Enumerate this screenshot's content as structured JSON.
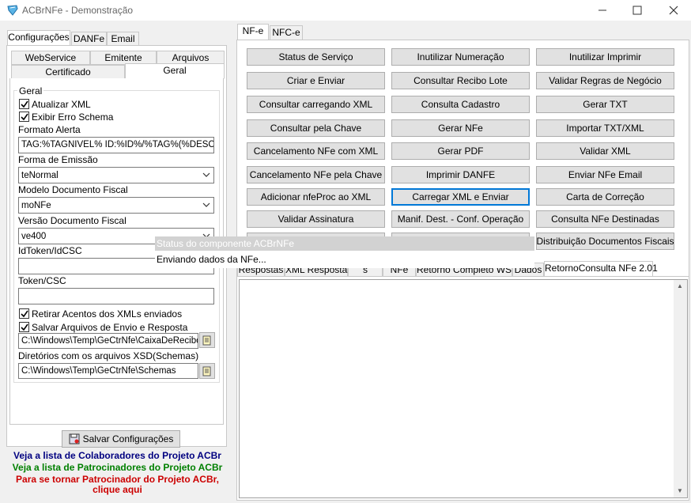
{
  "window": {
    "title": "ACBrNFe - Demonstração"
  },
  "left": {
    "tabs": [
      "Configurações",
      "DANFe",
      "Email"
    ],
    "subtabs_row1": [
      "WebService",
      "Emitente",
      "Arquivos"
    ],
    "subtabs_row2": [
      "Certificado",
      "Geral"
    ],
    "group_title": "Geral",
    "atualizar_xml": "Atualizar XML",
    "exibir_erro": "Exibir Erro Schema",
    "formato_alerta_label": "Formato Alerta",
    "formato_alerta_value": "TAG:%TAGNIVEL% ID:%ID%/%TAG%(%DESCRICAO%",
    "forma_emissao_label": "Forma de Emissão",
    "forma_emissao_value": "teNormal",
    "modelo_label": "Modelo Documento Fiscal",
    "modelo_value": "moNFe",
    "versao_label": "Versão Documento Fiscal",
    "versao_value": "ve400",
    "idtoken_label": "IdToken/IdCSC",
    "idtoken_value": "",
    "token_label": "Token/CSC",
    "token_value": "",
    "retirar_acentos": "Retirar Acentos dos XMLs enviados",
    "salvar_arquivos": "Salvar Arquivos de Envio e Resposta",
    "path_salvar": "C:\\Windows\\Temp\\GeCtrNfe\\CaixaDeRecibos",
    "schemas_label": "Diretórios com os arquivos XSD(Schemas)",
    "path_schemas": "C:\\Windows\\Temp\\GeCtrNfe\\Schemas",
    "save_button": "Salvar Configurações",
    "link_colab": "Veja a lista de Colaboradores do Projeto ACBr",
    "link_patroc": "Veja a lista de Patrocinadores do Projeto ACBr",
    "link_tornar1": "Para se tornar Patrocinador do Projeto ACBr,",
    "link_tornar2": "clique aqui",
    "link_colors": {
      "colab": "#000080",
      "patroc": "#008000",
      "tornar": "#cc0000"
    }
  },
  "right": {
    "tabs": [
      "NF-e",
      "NFC-e"
    ],
    "buttons": [
      [
        "Status de Serviço",
        "Inutilizar Numeração",
        "Inutilizar Imprimir"
      ],
      [
        "Criar e Enviar",
        "Consultar Recibo Lote",
        "Validar Regras de Negócio"
      ],
      [
        "Consultar carregando XML",
        "Consulta Cadastro",
        "Gerar TXT"
      ],
      [
        "Consultar pela Chave",
        "Gerar NFe",
        "Importar TXT/XML"
      ],
      [
        "Cancelamento NFe com XML",
        "Gerar PDF",
        "Validar XML"
      ],
      [
        "Cancelamento NFe pela Chave",
        "Imprimir DANFE",
        "Enviar NFe Email"
      ],
      [
        "Adicionar nfeProc ao XML",
        "Carregar XML e Enviar",
        "Carta de Correção"
      ],
      [
        "Validar Assinatura",
        "Manif. Dest. - Conf. Operação",
        "Consulta NFe Destinadas"
      ],
      [
        "",
        "",
        "Distribuição Documentos Fiscais"
      ]
    ],
    "bottom_tabs": [
      "Respostas",
      "XML Resposta",
      "s",
      "NFe",
      "Retorno Completo WS",
      "Dados",
      "RetornoConsulta NFe 2.01"
    ]
  },
  "status_popup": {
    "title": "Status do componente ACBrNFe",
    "message": "Enviando dados da NFe..."
  }
}
